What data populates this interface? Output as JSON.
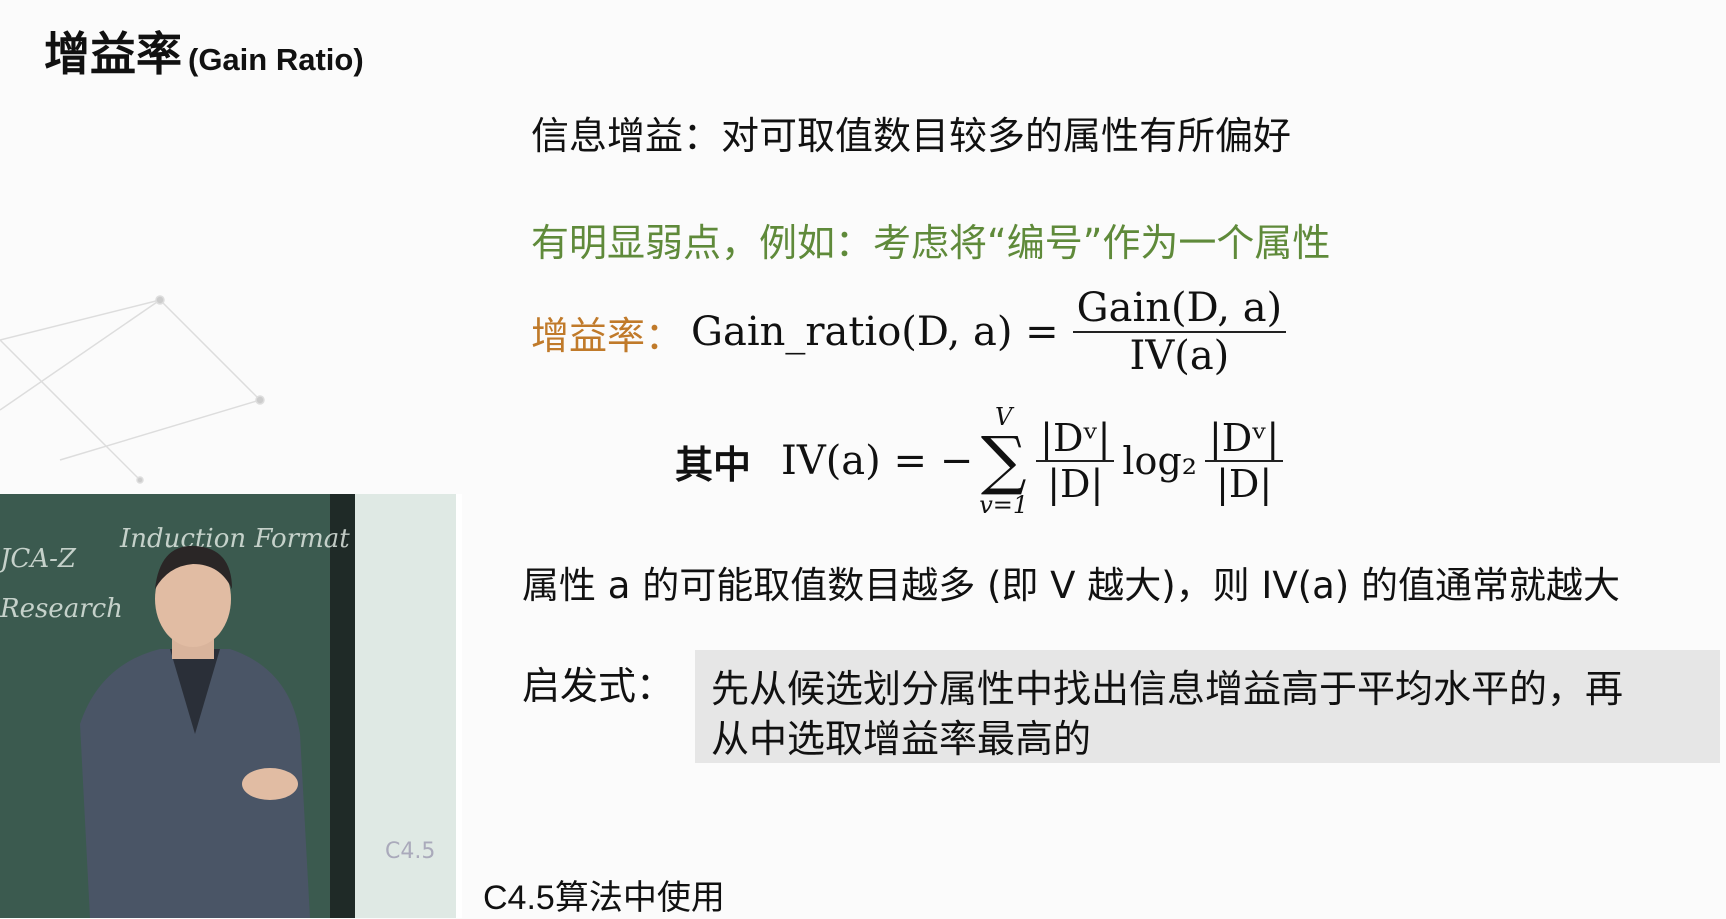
{
  "slide": {
    "title_zh": "增益率",
    "title_en": "(Gain Ratio)",
    "line1": "信息增益：对可取值数目较多的属性有所偏好",
    "line2": "有明显弱点，例如：考虑将“编号”作为一个属性",
    "gain_ratio_label": "增益率：",
    "gain_ratio_formula": {
      "lhs": "Gain_ratio(D, a) =",
      "numerator": "Gain(D, a)",
      "denominator": "IV(a)"
    },
    "iv_label": "其中",
    "iv_formula": {
      "lhs": "IV(a) = −",
      "sum_upper": "V",
      "sum_lower": "v=1",
      "frac_num": "|Dᵛ|",
      "frac_den": "|D|",
      "log": "log₂"
    },
    "line3": "属性 a 的可能取值数目越多 (即 V 越大)，则 IV(a) 的值通常就越大",
    "heuristic_label": "启发式：",
    "heuristic_text_1": "先从候选划分属性中找出信息增益高于平均水平的，再",
    "heuristic_text_2": "从中选取增益率最高的",
    "footer": "C4.5算法中使用"
  },
  "video": {
    "board_text_1": "Induction Format",
    "board_text_2": "Research",
    "board_text_3": "JCA-Z",
    "screen_text": "C4.5"
  },
  "colors": {
    "green": "#5f8a3a",
    "orange": "#c07a2a",
    "box": "#e6e6e6"
  }
}
